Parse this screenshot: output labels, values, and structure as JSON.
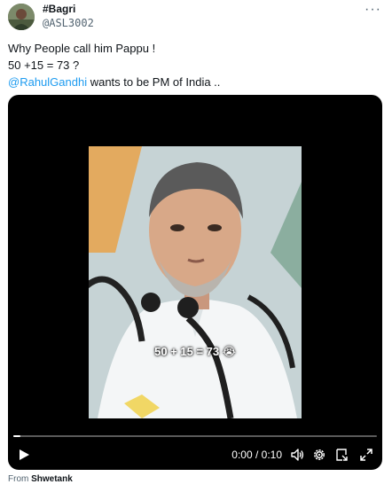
{
  "tweet": {
    "display_name": "#Bagri",
    "handle": "@ASL3002",
    "more_icon": "ellipsis-icon",
    "text_line1": "Why People call him Pappu !",
    "text_line2": "50 +15 = 73 ?",
    "mention": "@RahulGandhi",
    "text_line3_rest": " wants to be PM of India .."
  },
  "video": {
    "caption": "50 + 15 = 73 😭",
    "time": "0:00 / 0:10",
    "progress": 0.02,
    "controls": {
      "play": "play-icon",
      "volume": "volume-icon",
      "settings": "gear-icon",
      "pip": "picture-in-picture-icon",
      "fullscreen": "fullscreen-icon"
    }
  },
  "source": {
    "prefix": "From ",
    "name": "Shwetank"
  }
}
